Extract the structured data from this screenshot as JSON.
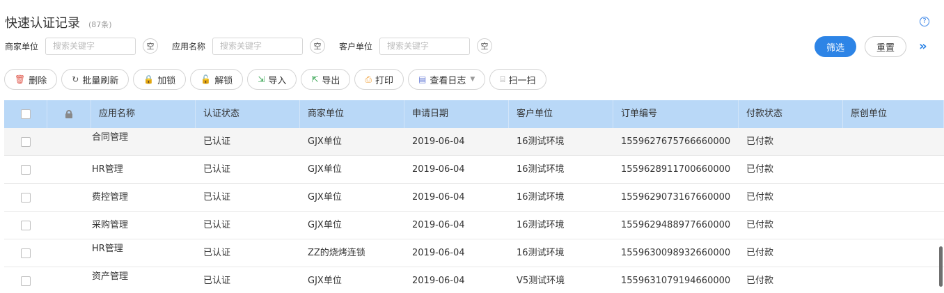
{
  "header": {
    "title": "快速认证记录",
    "count": "(87条)",
    "help_icon": "?"
  },
  "filters": [
    {
      "label": "商家单位",
      "placeholder": "搜索关键字",
      "clear_label": "空"
    },
    {
      "label": "应用名称",
      "placeholder": "搜索关键字",
      "clear_label": "空"
    },
    {
      "label": "客户单位",
      "placeholder": "搜索关键字",
      "clear_label": "空"
    }
  ],
  "actions": {
    "filter_label": "筛选",
    "reset_label": "重置",
    "expand_icon": "»"
  },
  "toolbar": [
    {
      "label": "删除",
      "icon": "trash-icon",
      "glyph": "🗑",
      "color": "#e05a4e"
    },
    {
      "label": "批量刷新",
      "icon": "refresh-icon",
      "glyph": "↻",
      "color": "#555555"
    },
    {
      "label": "加锁",
      "icon": "lock-icon",
      "glyph": "🔒",
      "color": "#2d84e6"
    },
    {
      "label": "解锁",
      "icon": "unlock-icon",
      "glyph": "🔓",
      "color": "#2d84e6"
    },
    {
      "label": "导入",
      "icon": "import-icon",
      "glyph": "⇲",
      "color": "#3aa655"
    },
    {
      "label": "导出",
      "icon": "export-icon",
      "glyph": "⇱",
      "color": "#3aa655"
    },
    {
      "label": "打印",
      "icon": "print-icon",
      "glyph": "⎙",
      "color": "#f09a2b"
    },
    {
      "label": "查看日志",
      "icon": "log-icon",
      "glyph": "▤",
      "color": "#6b7fd8",
      "caret": "▼"
    },
    {
      "label": "扫一扫",
      "icon": "scan-icon",
      "glyph": "⌸",
      "color": "#999999"
    }
  ],
  "table": {
    "columns": [
      "应用名称",
      "认证状态",
      "商家单位",
      "申请日期",
      "客户单位",
      "订单编号",
      "付款状态",
      "原创单位"
    ],
    "rows": [
      {
        "app": "合同管理",
        "status": "已认证",
        "merchant": "GJX单位",
        "date": "2019-06-04",
        "customer": "16测试环境",
        "order": "1559627675766660000",
        "payment": "已付款",
        "origin": ""
      },
      {
        "app": "HR管理",
        "status": "已认证",
        "merchant": "GJX单位",
        "date": "2019-06-04",
        "customer": "16测试环境",
        "order": "1559628911700660000",
        "payment": "已付款",
        "origin": ""
      },
      {
        "app": "费控管理",
        "status": "已认证",
        "merchant": "GJX单位",
        "date": "2019-06-04",
        "customer": "16测试环境",
        "order": "1559629073167660000",
        "payment": "已付款",
        "origin": ""
      },
      {
        "app": "采购管理",
        "status": "已认证",
        "merchant": "GJX单位",
        "date": "2019-06-04",
        "customer": "16测试环境",
        "order": "1559629488977660000",
        "payment": "已付款",
        "origin": ""
      },
      {
        "app": "HR管理",
        "status": "已认证",
        "merchant": "ZZ的烧烤连锁",
        "date": "2019-06-04",
        "customer": "16测试环境",
        "order": "1559630098932660000",
        "payment": "已付款",
        "origin": ""
      },
      {
        "app": "资产管理",
        "status": "已认证",
        "merchant": "GJX单位",
        "date": "2019-06-04",
        "customer": "V5测试环境",
        "order": "1559631079194660000",
        "payment": "已付款",
        "origin": ""
      }
    ]
  }
}
